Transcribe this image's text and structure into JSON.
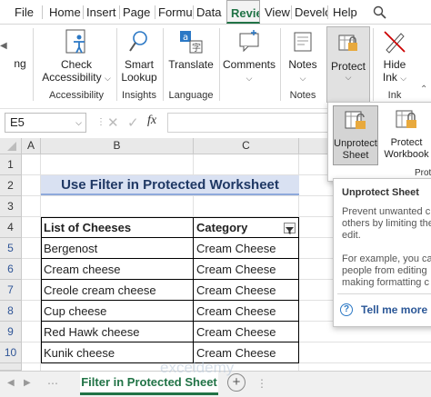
{
  "menubar": {
    "tabs": [
      "File",
      "Home",
      "Insert",
      "Page L",
      "Formu",
      "Data",
      "Review",
      "View",
      "Develo",
      "Help"
    ]
  },
  "ribbon": {
    "partial_label": "ng",
    "check_accessibility": {
      "line1": "Check",
      "line2": "Accessibility"
    },
    "accessibility_group": "Accessibility",
    "smart_lookup": {
      "line1": "Smart",
      "line2": "Lookup"
    },
    "insights_group": "Insights",
    "translate": "Translate",
    "language_group": "Language",
    "comments": "Comments",
    "notes": "Notes",
    "notes_group": "Notes",
    "protect": "Protect",
    "hide_ink": {
      "line1": "Hide",
      "line2": "Ink"
    },
    "ink_group": "Ink"
  },
  "formula_bar": {
    "name_box": "E5",
    "fx": "fx"
  },
  "grid": {
    "columns": [
      "A",
      "B",
      "C"
    ],
    "rows": [
      "1",
      "2",
      "3",
      "4",
      "5",
      "6",
      "7",
      "8",
      "9",
      "10"
    ],
    "title": "Use Filter in Protected Worksheet",
    "table_headers": [
      "List of Cheeses",
      "Category"
    ],
    "table_rows": [
      [
        "Bergenost",
        "Cream Cheese"
      ],
      [
        "Cream cheese",
        "Cream Cheese"
      ],
      [
        "Creole cream cheese",
        "Cream Cheese"
      ],
      [
        "Cup cheese",
        "Cream Cheese"
      ],
      [
        "Red Hawk cheese",
        "Cream Cheese"
      ],
      [
        "Kunik cheese",
        "Cream Cheese"
      ]
    ]
  },
  "protect_menu": {
    "unprotect_sheet": {
      "line1": "Unprotect",
      "line2": "Sheet"
    },
    "protect_workbook": {
      "line1": "Protect",
      "line2": "Workbook"
    },
    "group_partial": "Prot"
  },
  "tooltip": {
    "title": "Unprotect Sheet",
    "line1": "Prevent unwanted ch",
    "line2": "others by limiting the",
    "line3": "edit.",
    "line4": "For example, you can",
    "line5": "people from editing",
    "line6": "making formatting c",
    "tell_me_more": "Tell me more"
  },
  "sheet_tabs": {
    "active": "Filter in Protected Sheet",
    "watermark": "exceldemy"
  },
  "colors": {
    "excel_green": "#217346",
    "title_fill": "#d9e1f2",
    "title_text": "#1f3864",
    "row_number_blue": "#2f5597"
  }
}
